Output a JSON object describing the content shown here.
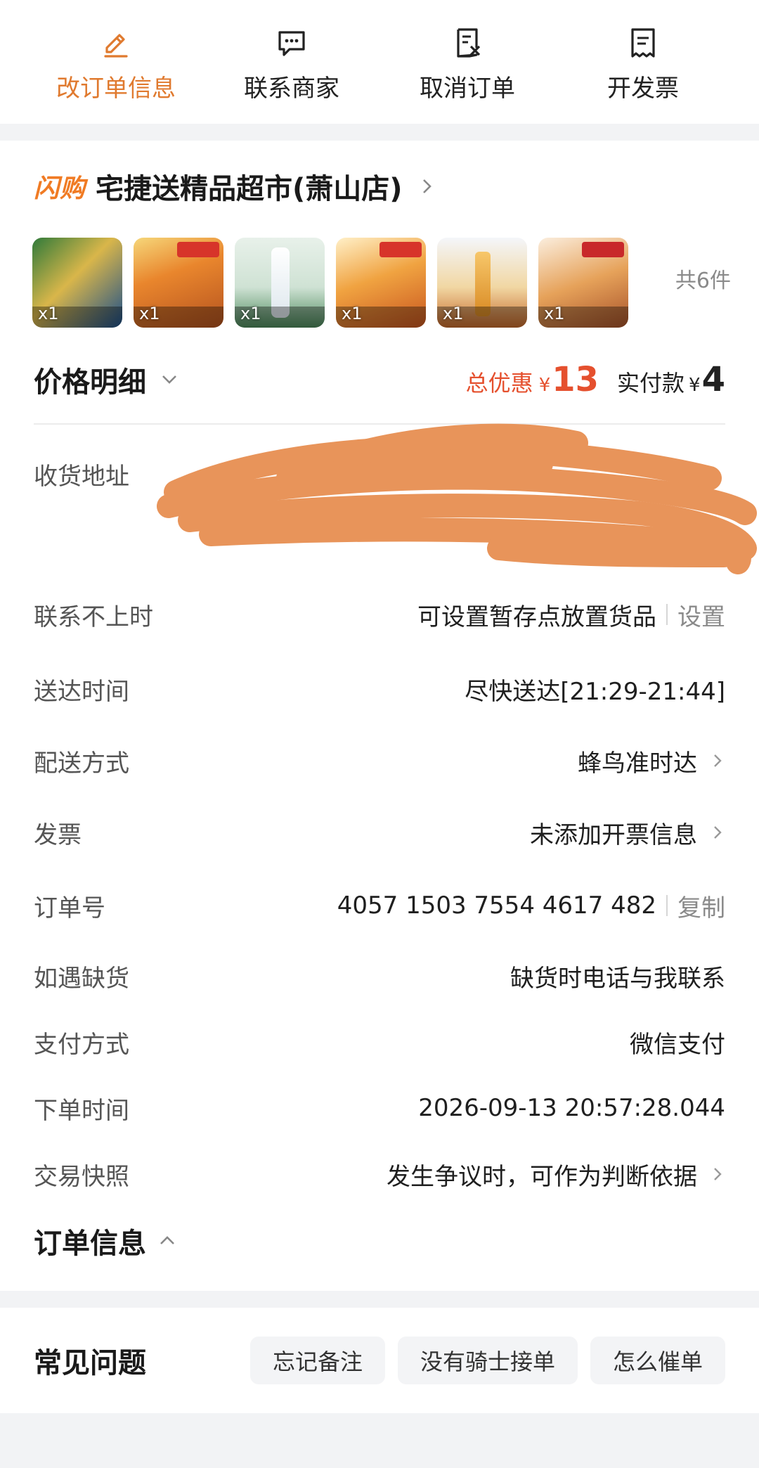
{
  "actions": [
    {
      "label": "改订单信息",
      "icon": "edit-icon",
      "active": true
    },
    {
      "label": "联系商家",
      "icon": "chat-icon",
      "active": false
    },
    {
      "label": "取消订单",
      "icon": "cancel-order-icon",
      "active": false
    },
    {
      "label": "开发票",
      "icon": "invoice-icon",
      "active": false
    }
  ],
  "store": {
    "tag": "闪购",
    "name": "宅捷送精品超市(萧山店)"
  },
  "items": {
    "quantities": [
      "x1",
      "x1",
      "x1",
      "x1",
      "x1",
      "x1"
    ],
    "total_count": "共6件"
  },
  "price": {
    "title": "价格明细",
    "discount_label": "总优惠",
    "currency": "¥",
    "discount_amount": "13",
    "paid_label": "实付款",
    "paid_amount": "4"
  },
  "address": {
    "label": "收货地址"
  },
  "details": {
    "contact": {
      "key": "联系不上时",
      "value": "可设置暂存点放置货品",
      "action": "设置"
    },
    "delivery_time": {
      "key": "送达时间",
      "value": "尽快送达[21:29-21:44]"
    },
    "delivery_method": {
      "key": "配送方式",
      "value": "蜂鸟准时达"
    },
    "invoice": {
      "key": "发票",
      "value": "未添加开票信息"
    },
    "order_no": {
      "key": "订单号",
      "value": "4057 1503 7554 4617 482",
      "action": "复制"
    },
    "out_of_stock": {
      "key": "如遇缺货",
      "value": "缺货时电话与我联系"
    },
    "payment": {
      "key": "支付方式",
      "value": "微信支付"
    },
    "order_time": {
      "key": "下单时间",
      "value": "2026-09-13 20:57:28.044"
    },
    "snapshot": {
      "key": "交易快照",
      "value": "发生争议时，可作为判断依据"
    }
  },
  "order_info": {
    "title": "订单信息"
  },
  "faq": {
    "title": "常见问题",
    "chips": [
      "忘记备注",
      "没有骑士接单",
      "怎么催单"
    ]
  },
  "colors": {
    "accent": "#e07a2f",
    "discount": "#e5502e",
    "scribble": "#e8945a"
  }
}
